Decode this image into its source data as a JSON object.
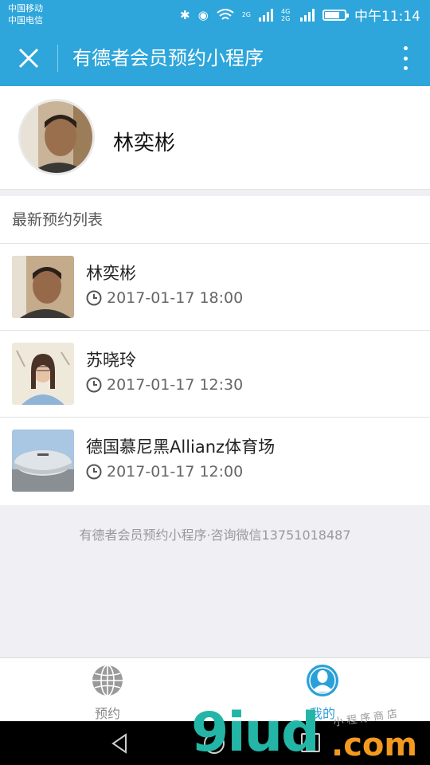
{
  "status_bar": {
    "carrier_1": "中国移动",
    "carrier_2": "中国电信",
    "net_1": "2G",
    "net_2": "4G 2G",
    "time": "中午11:14"
  },
  "nav": {
    "title": "有德者会员预约小程序"
  },
  "profile": {
    "name": "林奕彬"
  },
  "bookings": {
    "title": "最新预约列表",
    "items": [
      {
        "name": "林奕彬",
        "time": "2017-01-17 18:00"
      },
      {
        "name": "苏晓玲",
        "time": "2017-01-17 12:30"
      },
      {
        "name": "德国慕尼黑Allianz体育场",
        "time": "2017-01-17 12:00"
      }
    ]
  },
  "footer": {
    "text": "有德者会员预约小程序·咨询微信13751018487"
  },
  "tabbar": {
    "tabs": [
      {
        "label": "预约",
        "icon": "globe-icon"
      },
      {
        "label": "我的",
        "icon": "user-icon"
      }
    ],
    "active_color": "#2aa0d8"
  },
  "watermark": {
    "brand": "9iud",
    "suffix": ".com",
    "tagline": "小程序商店"
  },
  "colors": {
    "primary": "#2ea6db",
    "background": "#efeff4"
  }
}
